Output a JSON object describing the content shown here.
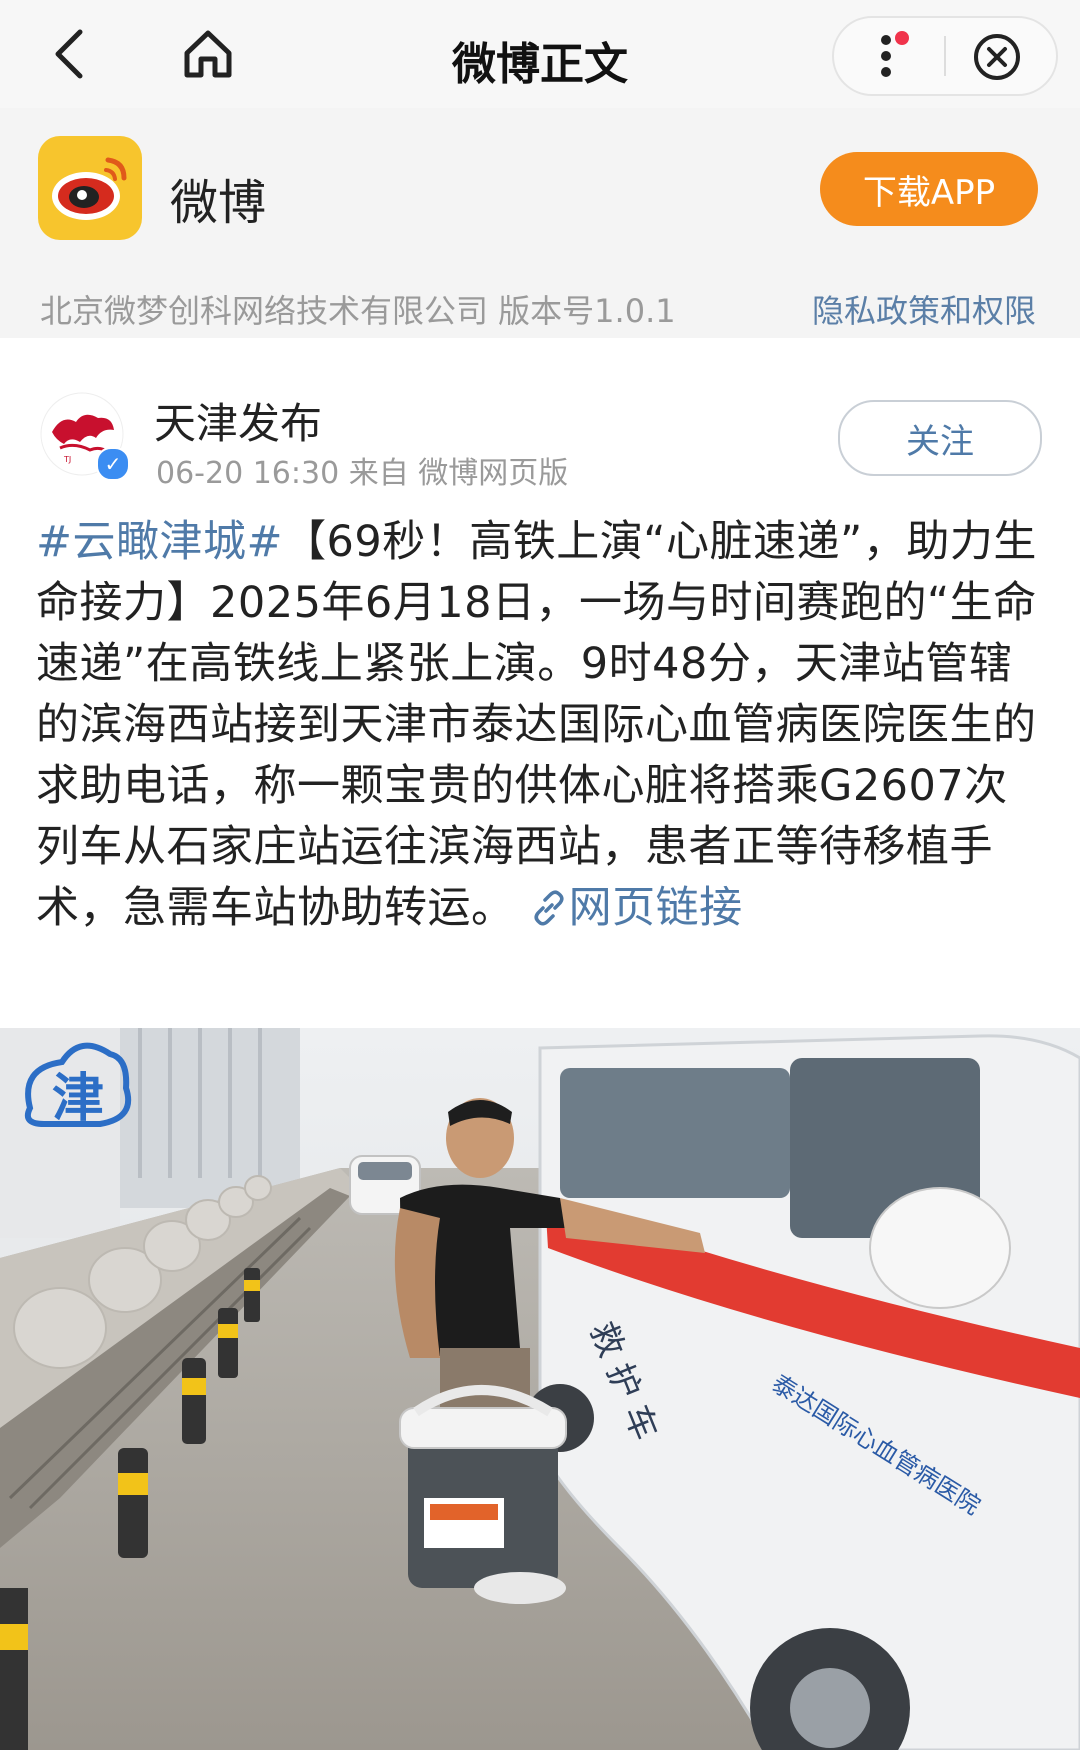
{
  "nav": {
    "title": "微博正文"
  },
  "app_banner": {
    "app_name": "微博",
    "download_label": "下载APP",
    "company": "北京微梦创科网络技术有限公司 版本号1.0.1",
    "privacy_label": "隐私政策和权限"
  },
  "post": {
    "author": "天津发布",
    "meta": "06-20 16:30 来自 微博网页版",
    "follow_label": "关注",
    "hashtag": "#云瞰津城#",
    "body": "【69秒！高铁上演“心脏速递”，助力生命接力】2025年6月18日，一场与时间赛跑的“生命速递”在高铁线上紧张上演。9时48分，天津站管辖的滨海西站接到天津市泰达国际心血管病医院医生的求助电话，称一颗宝贵的供体心脏将搭乘G2607次列车从石家庄站运往滨海西站，患者正等待移植手术，急需车站协助转运。",
    "link_label": "网页链接"
  },
  "photo": {
    "watermark": "津",
    "vehicle_text_1": "救 护 车",
    "vehicle_text_2": "泰达国际心血管病医院"
  },
  "colors": {
    "accent_link": "#4f7aa8",
    "download_orange": "#f58c1c",
    "weibo_yellow": "#f7c52d"
  }
}
